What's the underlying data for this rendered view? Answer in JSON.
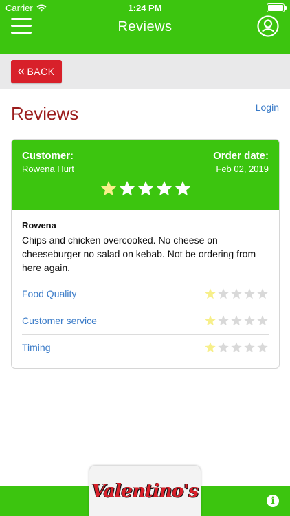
{
  "status_bar": {
    "carrier": "Carrier",
    "time": "1:24 PM"
  },
  "header": {
    "title": "Reviews",
    "menu_icon": "hamburger-icon",
    "profile_icon": "user-circle-icon"
  },
  "back_button": {
    "label": "BACK",
    "icon": "double-chevron-left-icon"
  },
  "page": {
    "title": "Reviews",
    "login_link": "Login"
  },
  "review": {
    "customer_label": "Customer:",
    "customer_name": "Rowena Hurt",
    "order_date_label": "Order date:",
    "order_date": "Feb 02, 2019",
    "overall_rating": 1,
    "max_rating": 5,
    "reviewer_name": "Rowena",
    "comment": "Chips and chicken overcooked. No cheese on cheeseburger no salad on kebab. Not be ordering from here again.",
    "metrics": [
      {
        "label": "Food Quality",
        "rating": 1
      },
      {
        "label": "Customer service",
        "rating": 1
      },
      {
        "label": "Timing",
        "rating": 1
      }
    ]
  },
  "footer": {
    "logo_text": "Valentino's",
    "info_icon": "info-icon"
  },
  "colors": {
    "brand_green": "#3cc50f",
    "back_red": "#d8202a",
    "title_red": "#9b1c1c",
    "link_blue": "#3a7bc8",
    "star_filled": "#f7ef8a",
    "star_empty": "#d9d9d9"
  }
}
